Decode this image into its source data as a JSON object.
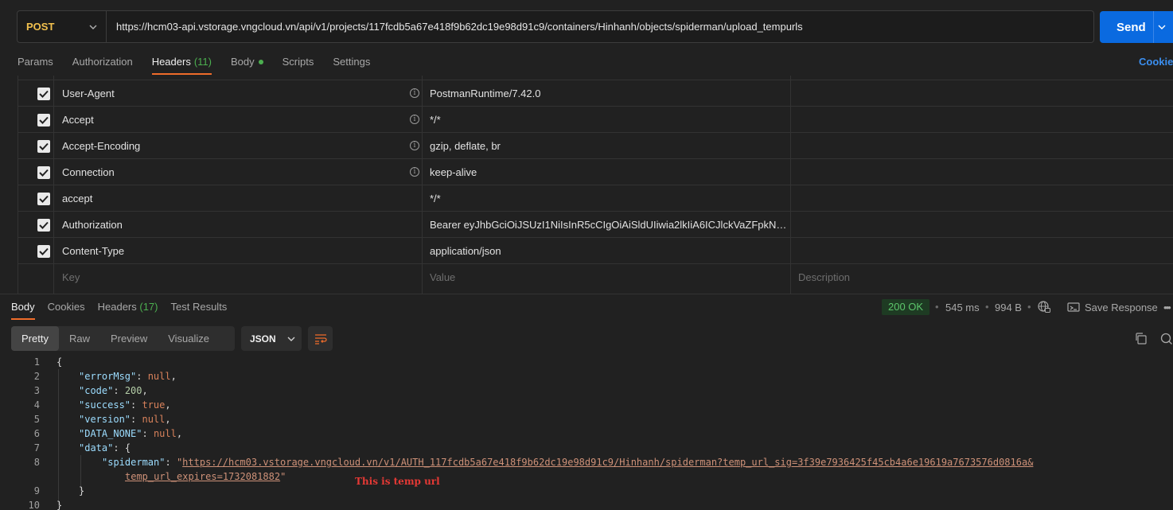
{
  "request": {
    "method": "POST",
    "url": "https://hcm03-api.vstorage.vngcloud.vn/api/v1/projects/117fcdb5a67e418f9b62dc19e98d91c9/containers/Hinhanh/objects/spiderman/upload_tempurls",
    "send_label": "Send"
  },
  "req_tabs": {
    "params": "Params",
    "authorization": "Authorization",
    "headers": "Headers",
    "headers_count": "(11)",
    "body": "Body",
    "scripts": "Scripts",
    "settings": "Settings",
    "cookies": "Cookies"
  },
  "headers_table": {
    "rows": [
      {
        "key": "User-Agent",
        "value": "PostmanRuntime/7.42.0"
      },
      {
        "key": "Accept",
        "value": "*/*"
      },
      {
        "key": "Accept-Encoding",
        "value": "gzip, deflate, br"
      },
      {
        "key": "Connection",
        "value": "keep-alive"
      },
      {
        "key": "accept",
        "value": "*/*"
      },
      {
        "key": "Authorization",
        "value": "Bearer eyJhbGciOiJSUzI1NiIsInR5cCIgOiAiSldUIiwia2lkIiA6ICJlckVaZFpkNkRs..."
      },
      {
        "key": "Content-Type",
        "value": "application/json"
      }
    ],
    "placeholder_key": "Key",
    "placeholder_value": "Value",
    "placeholder_description": "Description"
  },
  "resp_tabs": {
    "body": "Body",
    "cookies": "Cookies",
    "headers": "Headers",
    "headers_count": "(17)",
    "test_results": "Test Results"
  },
  "response_meta": {
    "status": "200 OK",
    "time": "545 ms",
    "size": "994 B",
    "save": "Save Response",
    "dot": "•",
    "more": "•••"
  },
  "view_modes": [
    "Pretty",
    "Raw",
    "Preview",
    "Visualize"
  ],
  "format": "JSON",
  "code_lines": {
    "l1": "{",
    "l2_key": "\"errorMsg\"",
    "l2_val": "null",
    "l3_key": "\"code\"",
    "l3_val": "200",
    "l4_key": "\"success\"",
    "l4_val": "true",
    "l5_key": "\"version\"",
    "l5_val": "null",
    "l6_key": "\"DATA_NONE\"",
    "l6_val": "null",
    "l7_key": "\"data\"",
    "l7_brace": "{",
    "l8_key": "\"spiderman\"",
    "l8_url_a": "https://hcm03.vstorage.vngcloud.vn/v1/AUTH_117fcdb5a67e418f9b62dc19e98d91c9/Hinhanh/spiderman?temp_url_sig=3f39e7936425f45cb4a6e19619a7673576d0816a&",
    "l8_url_b": "temp_url_expires=1732081882",
    "l9": "}",
    "l10": "}"
  },
  "line_numbers": [
    "1",
    "2",
    "3",
    "4",
    "5",
    "6",
    "7",
    "8",
    "9",
    "10"
  ],
  "annotation": "This is temp url"
}
